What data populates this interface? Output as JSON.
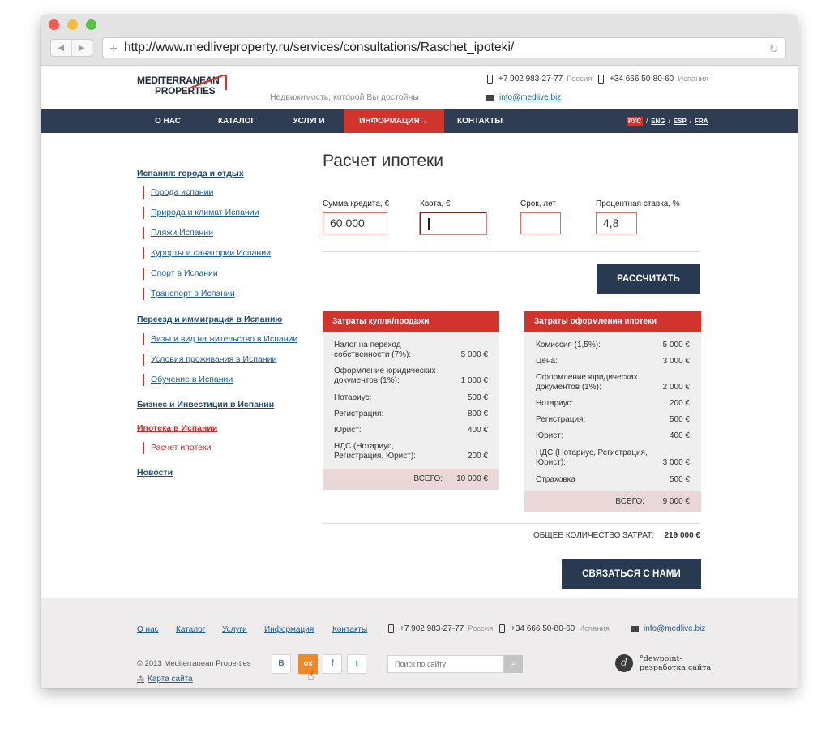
{
  "browser": {
    "url": "http://www.medliveproperty.ru/services/consultations/Raschet_ipoteki/"
  },
  "header": {
    "logo_line1": "MEDITERRANEAN",
    "logo_line2": "PROPERTIES",
    "tagline": "Недвижимость, которой Вы достойны",
    "phone_ru": "+7 902 983-27-77",
    "phone_ru_country": "Россия",
    "phone_es": "+34 666 50-80-60",
    "phone_es_country": "Испания",
    "email": "info@medlive.biz"
  },
  "nav": {
    "items": [
      "О НАС",
      "КАТАЛОГ",
      "УСЛУГИ",
      "ИНФОРМАЦИЯ",
      "КОНТАКТЫ"
    ],
    "active_arrow": "⌄",
    "langs": [
      "РУС",
      "ENG",
      "ESP",
      "FRA"
    ],
    "lang_sep": "/"
  },
  "sidebar": {
    "sections": [
      {
        "title": "Испания: города и отдых",
        "items": [
          "Города испании",
          "Природа и климат Испании",
          "Пляжи Испании",
          "Курорты и санатории Испании",
          "Спорт в Испании",
          "Транспорт в Испании"
        ]
      },
      {
        "title": "Переезд и иммиграция в Испанию",
        "items": [
          "Визы и вид на жительство в Испании",
          "Условия проживания в Испании",
          "Обучение в Испании"
        ]
      },
      {
        "title": "Бизнес и Инвестиции в Испании",
        "items": []
      },
      {
        "title": "Ипотека в Испании",
        "items": [
          "Расчет ипотеки"
        ]
      },
      {
        "title": "Новости",
        "items": []
      }
    ]
  },
  "calculator": {
    "title": "Расчет ипотеки",
    "fields": [
      {
        "label": "Сумма кредита, €",
        "value": "60 000"
      },
      {
        "label": "Квота, €",
        "value": ""
      },
      {
        "label": "Срок, лет",
        "value": ""
      },
      {
        "label": "Процентная ставка, %",
        "value": "4,8"
      }
    ],
    "calc_button": "РАССЧИТАТЬ",
    "table1": {
      "title": "Затраты купля/продажи",
      "rows": [
        {
          "label": "Налог на переход собственности (7%):",
          "value": "5 000 €"
        },
        {
          "label": "Оформление юридических документов (1%):",
          "value": "1 000 €"
        },
        {
          "label": "Нотариус:",
          "value": "500 €"
        },
        {
          "label": "Регистрация:",
          "value": "800 €"
        },
        {
          "label": "Юрист:",
          "value": "400 €"
        },
        {
          "label": "НДС (Нотариус, Регистрация, Юрист):",
          "value": "200 €"
        }
      ],
      "total_label": "ВСЕГО:",
      "total_value": "10 000 €"
    },
    "table2": {
      "title": "Затраты оформления ипотеки",
      "rows": [
        {
          "label": "Комиссия (1,5%):",
          "value": "5 000 €"
        },
        {
          "label": "Цена:",
          "value": "3 000 €"
        },
        {
          "label": "Оформление юридических документов (1%):",
          "value": "2 000 €"
        },
        {
          "label": "Нотариус:",
          "value": "200 €"
        },
        {
          "label": "Регистрация:",
          "value": "500 €"
        },
        {
          "label": "Юрист:",
          "value": "400 €"
        },
        {
          "label": "НДС (Нотариус, Регистрация, Юрист):",
          "value": "3 000 €"
        },
        {
          "label": "Страховка",
          "value": "500 €"
        }
      ],
      "total_label": "ВСЕГО:",
      "total_value": "9 000 €"
    },
    "grand_total_label": "ОБЩЕЕ КОЛИЧЕСТВО ЗАТРАТ:",
    "grand_total_value": "219 000 €",
    "contact_button": "СВЯЗАТЬСЯ С НАМИ"
  },
  "footer": {
    "links": [
      "О нас",
      "Каталог",
      "Услуги",
      "Информация",
      "Контакты"
    ],
    "phone_ru": "+7 902 983-27-77",
    "phone_ru_country": "Россия",
    "phone_es": "+34 666 50-80-60",
    "phone_es_country": "Испания",
    "email": "info@medlive.biz",
    "copyright": "© 2013 Mediterranean Properties",
    "sitemap": "Карта сайта",
    "social": {
      "vk": "В",
      "ok": "ок",
      "fb": "f",
      "tw": "t"
    },
    "search_placeholder": "Поиск по сайту",
    "dev_line1": "°dewpoint-",
    "dev_line2": "разработка сайта",
    "dev_logo": "d"
  }
}
